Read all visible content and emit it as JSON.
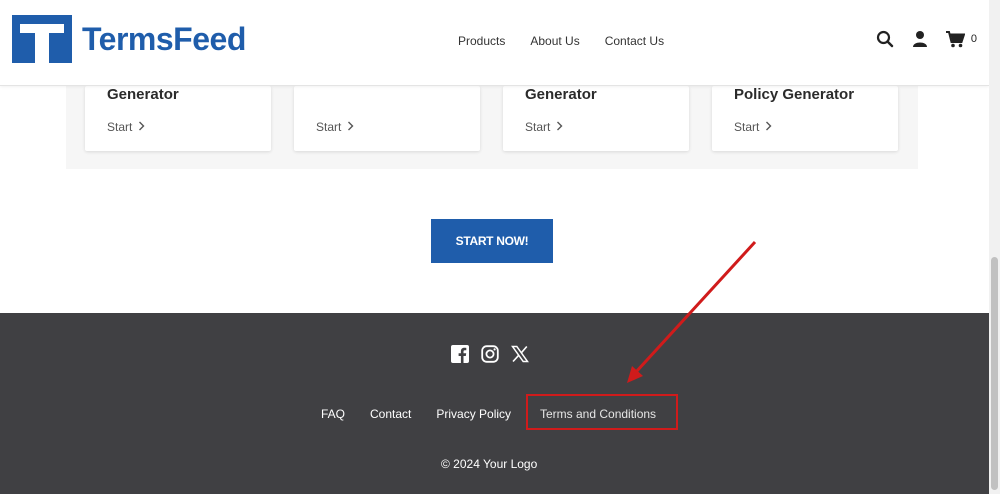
{
  "header": {
    "logo_text": "TermsFeed",
    "nav": [
      "Products",
      "About Us",
      "Contact Us"
    ],
    "cart_count": "0"
  },
  "cards": [
    {
      "title": "Generator",
      "start": "Start"
    },
    {
      "title": "",
      "start": "Start"
    },
    {
      "title": "Generator",
      "start": "Start"
    },
    {
      "title": "Policy Generator",
      "start": "Start"
    }
  ],
  "cta": {
    "label": "START NOW!"
  },
  "footer": {
    "social_icons": [
      "facebook-icon",
      "instagram-icon",
      "x-icon"
    ],
    "links": [
      "FAQ",
      "Contact",
      "Privacy Policy"
    ],
    "highlighted_link": "Terms and Conditions",
    "copyright": "© 2024 Your Logo"
  },
  "colors": {
    "brand": "#1f5dab",
    "footer_bg": "#404043",
    "annotation": "#d01b1b"
  }
}
